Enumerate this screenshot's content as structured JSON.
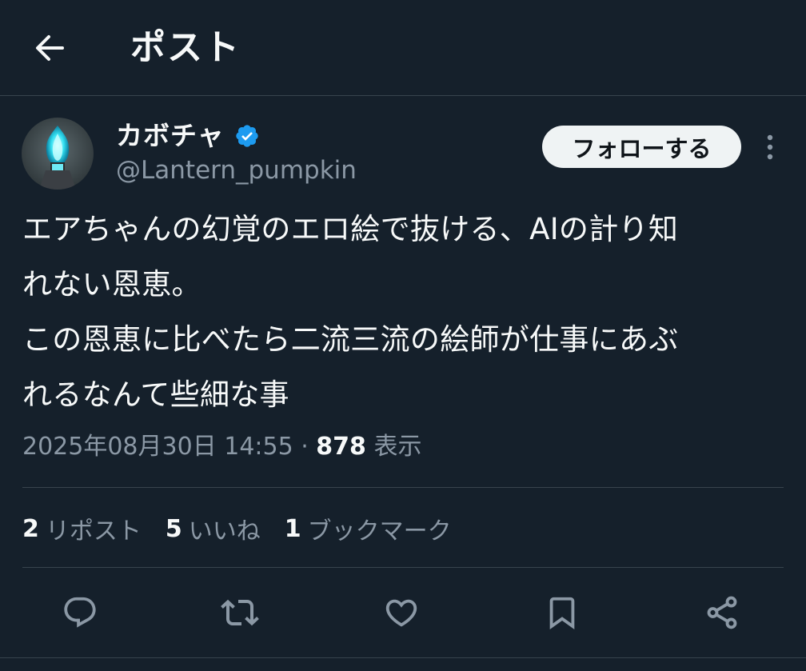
{
  "header": {
    "title": "ポスト",
    "back_icon": "arrow-left-icon"
  },
  "author": {
    "display_name": "カボチャ",
    "handle": "@Lantern_pumpkin",
    "verified": true,
    "verified_color": "#1d9bf0"
  },
  "follow_button_label": "フォローする",
  "more_icon": "more-vertical-icon",
  "tweet": {
    "text": "エアちゃんの幻覚のエロ絵で抜ける、AIの計り知\nれない恩恵。\nこの恩恵に比べたら二流三流の絵師が仕事にあぶ\nれるなんて些細な事",
    "timestamp": "2025年08月30日 14:55",
    "separator": " · ",
    "views_count": "878",
    "views_label": " 表示"
  },
  "stats": {
    "reposts_count": "2",
    "reposts_label": "リポスト",
    "likes_count": "5",
    "likes_label": "いいね",
    "bookmarks_count": "1",
    "bookmarks_label": "ブックマーク"
  },
  "actions": [
    "reply-icon",
    "repost-icon",
    "like-icon",
    "bookmark-icon",
    "share-icon"
  ],
  "colors": {
    "background": "#15202b",
    "text_primary": "#f7f9f9",
    "text_secondary": "#8b98a5",
    "divider": "#38444d",
    "accent": "#1d9bf0"
  }
}
